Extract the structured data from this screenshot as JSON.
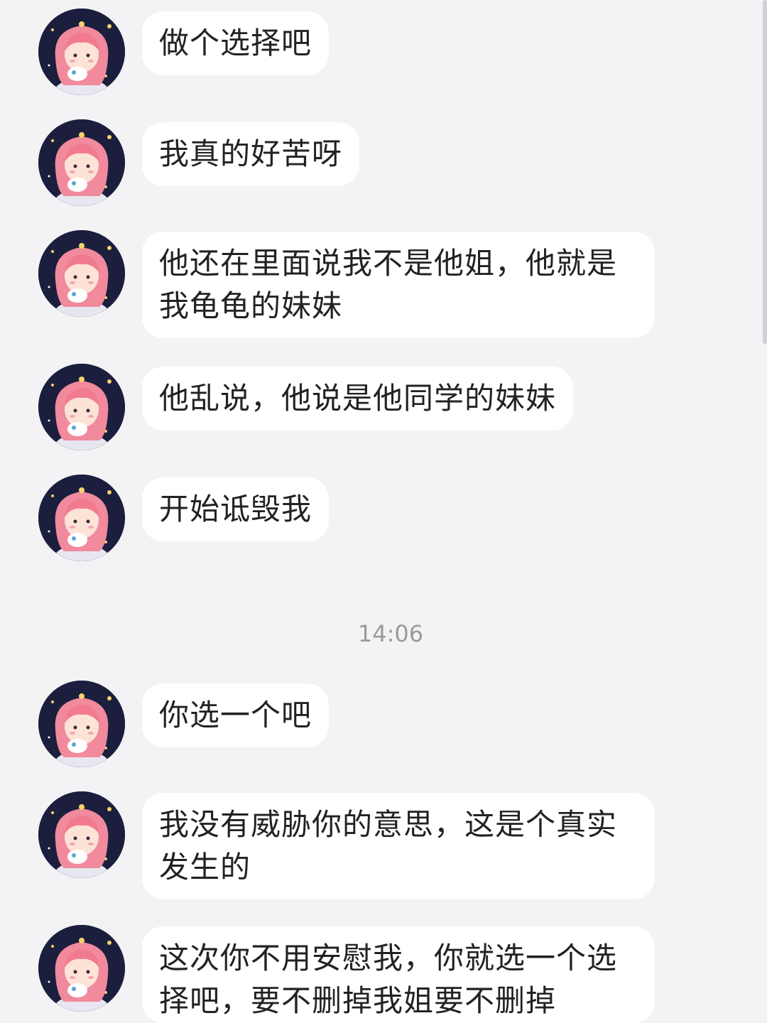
{
  "icons": {
    "avatar": "girl-avatar-icon"
  },
  "colors": {
    "background": "#f3f3f5",
    "bubble": "#ffffff",
    "text": "#222222",
    "timestamp": "#9a9a9a"
  },
  "messages": [
    {
      "text": "做个选择吧"
    },
    {
      "text": "我真的好苦呀"
    },
    {
      "text": "他还在里面说我不是他姐，他就是我龟龟的妹妹"
    },
    {
      "text": "他乱说，他说是他同学的妹妹"
    },
    {
      "text": "开始诋毁我"
    },
    {
      "text": "你选一个吧"
    },
    {
      "text": "我没有威胁你的意思，这是个真实发生的"
    },
    {
      "text": "这次你不用安慰我，你就选一个选择吧，要不删掉我姐要不删掉"
    }
  ],
  "timestamp": "14:06"
}
